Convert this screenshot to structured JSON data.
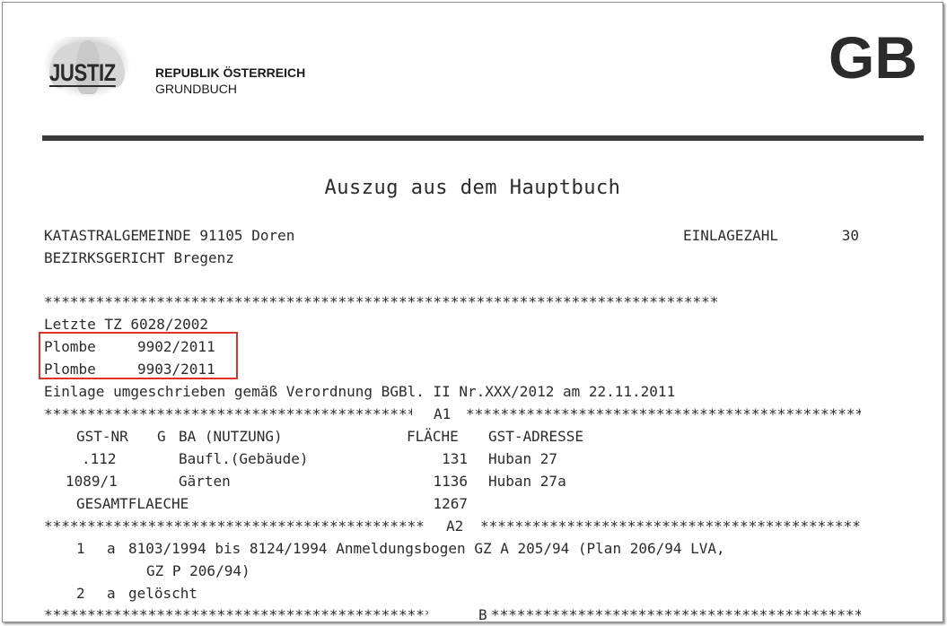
{
  "header": {
    "logo_text": "JUSTIZ",
    "republik": "REPUBLIK ÖSTERREICH",
    "grundbuch": "GRUNDBUCH",
    "badge": "GB"
  },
  "title": "Auszug aus dem Hauptbuch",
  "meta": {
    "katastral": "KATASTRALGEMEINDE 91105 Doren",
    "einlage_label": "EINLAGEZAHL",
    "einlage_value": "30",
    "bezirk": "BEZIRKSGERICHT Bregenz"
  },
  "stars": "******************************************************************************",
  "letzte_tz": "Letzte TZ 6028/2002",
  "plomben": [
    {
      "label": "Plombe",
      "value": "9902/2011"
    },
    {
      "label": "Plombe",
      "value": "9903/2011"
    }
  ],
  "einlage_note": "Einlage umgeschrieben gemäß Verordnung BGBl. II Nr.XXX/2012 am 22.11.2011",
  "sections": {
    "a1": "A1",
    "a2": "A2",
    "b": "B"
  },
  "a1_table": {
    "headers": {
      "gst_nr": "GST-NR",
      "g": "G",
      "ba": "BA (NUTZUNG)",
      "flaeche": "FLÄCHE",
      "adresse": "GST-ADRESSE"
    },
    "rows": [
      {
        "gst_nr": ".112",
        "ba": "Baufl.(Gebäude)",
        "flaeche": "131",
        "adresse": "Huban 27"
      },
      {
        "gst_nr": "1089/1",
        "ba": "Gärten",
        "flaeche": "1136",
        "adresse": "Huban 27a"
      }
    ],
    "total_label": "GESAMTFLAECHE",
    "total_value": "1267"
  },
  "a2_entries": [
    {
      "num": "1",
      "letter": "a",
      "text": "8103/1994 bis 8124/1994 Anmeldungsbogen GZ A 205/94 (Plan 206/94 LVA,",
      "cont": "GZ P 206/94)"
    },
    {
      "num": "2",
      "letter": "a",
      "text": "gelöscht",
      "cont": ""
    }
  ]
}
